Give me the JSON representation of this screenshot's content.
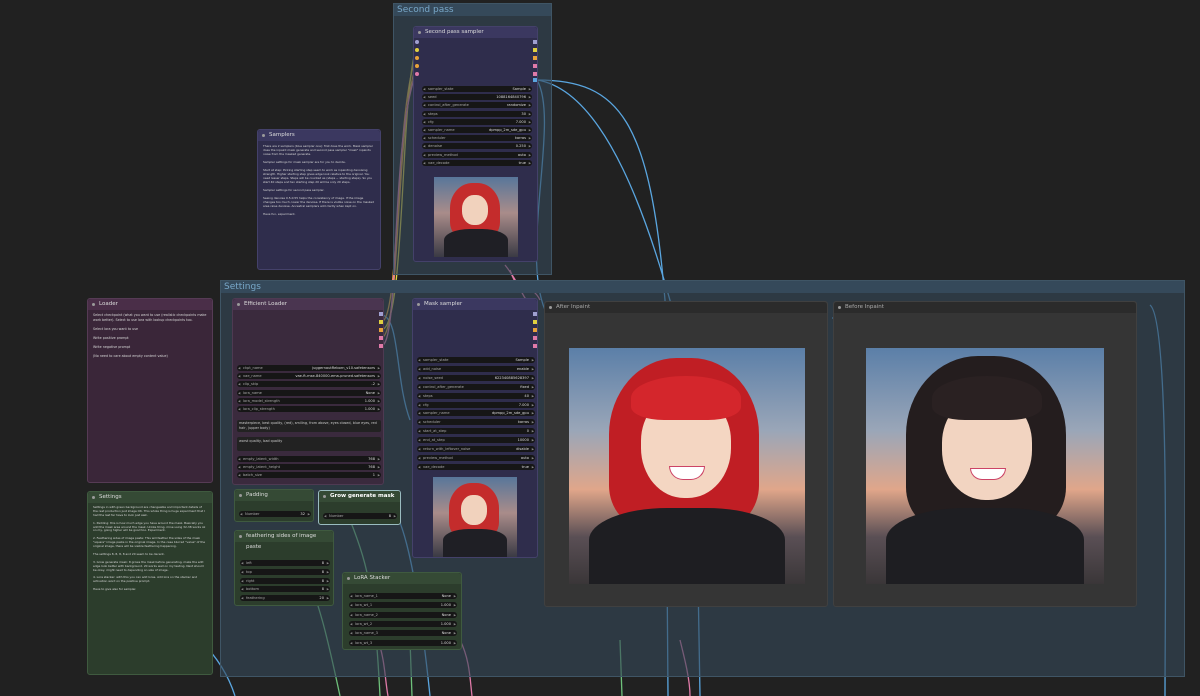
{
  "groups": {
    "second_pass": "Second pass",
    "settings": "Settings"
  },
  "nodes": {
    "loader": {
      "title": "Loader",
      "text": "Select checkpoint (what you want to use (realistic checkpoints make work better). Select to use lora with lookup checkpoints too.\n\nSelect lora you want to use\n\nWrite positive prompt\n\nWrite negative prompt\n\n(No need to care about empty content value)"
    },
    "samplers_note": {
      "title": "Samplers",
      "text": "There are 2 samplers (blue sampler one): first does the work. Mask sampler does the inpaint mask generate and second pass sampler \"mask\" inpaints noise from the masked generate.\n\nSampler settings for mask sampler are for you to decide.\n\nStart at step: Picking starting step seem to work as inpainting denoising strength. Higher starting step gives edge look relative to the original. You need lesser steps. Steps will be counted as (steps − starting steps). So you start 40 steps and ten starting step 20 will be only 20 steps.\n\nSampler settings for second pass sampler.\n\nSeeing denoise 0.5-0.55 helps the consistency of image. If the image changes too much, lower the denoise. If there is visible noise on the masked area raise denoise. Ancestral samplers add clarity when kept on.\n\nHave fun, experiment."
    },
    "settings_note": {
      "title": "Settings",
      "text": "Settings in with green background are changeable and important details of the rest production just image OK. This whole thing is huge experiment that I had the last far have to look just awk.\n\n1. Padding: this is how much edge you have around the mask. Basically you add the mask area around the mask. Unlike tiling, mine using 32-38 works ok on my, going higher will be good too. Experiment.\n\n2. Feathering sides of image paste: This will feather the sides of the mask \"square\" image paste in the original image. In the case blurred \"value\" of the original image, there will be visible feathering happening.\n\nThe settings 8, 8, 8, 8 and 20 seem to be decent.\n\n3. Grow generate mask: It grows the mask before generating, make the edit edge look better with background. 20 works well on my testing. Next should be okay, might need to depending on size of image.\n\n4. Lora stacker: with this you can add loras. Add lora on the stacker and activation word on the positive prompt.\n\nHave to give also for sampler."
    },
    "second_pass_sampler": {
      "title": "Second pass sampler",
      "widgets": [
        {
          "label": "sampler_state",
          "value": "Sample"
        },
        {
          "label": "seed",
          "value": "1088164840796"
        },
        {
          "label": "control_after_generate",
          "value": "randomize"
        },
        {
          "label": "steps",
          "value": "30"
        },
        {
          "label": "cfg",
          "value": "7.000"
        },
        {
          "label": "sampler_name",
          "value": "dpmpp_2m_sde_gpu"
        },
        {
          "label": "scheduler",
          "value": "karras"
        },
        {
          "label": "denoise",
          "value": "0.250"
        },
        {
          "label": "preview_method",
          "value": "auto"
        },
        {
          "label": "vae_decode",
          "value": "true"
        }
      ]
    },
    "efficient_loader": {
      "title": "Efficient Loader",
      "widgets": [
        {
          "label": "ckpt_name",
          "value": "juggernautReborn_v10.safetensors"
        },
        {
          "label": "vae_name",
          "value": "vae-ft-mse-840000-ema-pruned.safetensors"
        },
        {
          "label": "clip_skip",
          "value": "-2"
        },
        {
          "label": "lora_name",
          "value": "None"
        },
        {
          "label": "lora_model_strength",
          "value": "1.000"
        },
        {
          "label": "lora_clip_strength",
          "value": "1.000"
        }
      ],
      "positive": "masterpiece, best quality, (red), smiling, from above, eyes closed, blue eyes, red hair, (upper body)",
      "negative": "worst quality, bad quality",
      "widgets2": [
        {
          "label": "empty_latent_width",
          "value": "768"
        },
        {
          "label": "empty_latent_height",
          "value": "768"
        },
        {
          "label": "batch_size",
          "value": "1"
        }
      ]
    },
    "mask_sampler": {
      "title": "Mask sampler",
      "widgets": [
        {
          "label": "sampler_state",
          "value": "Sample"
        },
        {
          "label": "add_noise",
          "value": "enable"
        },
        {
          "label": "noise_seed",
          "value": "622340885628397"
        },
        {
          "label": "control_after_generate",
          "value": "fixed"
        },
        {
          "label": "steps",
          "value": "40"
        },
        {
          "label": "cfg",
          "value": "7.000"
        },
        {
          "label": "sampler_name",
          "value": "dpmpp_2m_sde_gpu"
        },
        {
          "label": "scheduler",
          "value": "karras"
        },
        {
          "label": "start_at_step",
          "value": "0"
        },
        {
          "label": "end_at_step",
          "value": "10000"
        },
        {
          "label": "return_with_leftover_noise",
          "value": "disable"
        },
        {
          "label": "preview_method",
          "value": "auto"
        },
        {
          "label": "vae_decode",
          "value": "true"
        }
      ]
    },
    "padding": {
      "title": "Padding",
      "widget": {
        "label": "Number",
        "value": "32"
      }
    },
    "grow_mask": {
      "title": "Grow generate mask",
      "widget": {
        "label": "Number",
        "value": "8"
      }
    },
    "feathering": {
      "title": "feathering sides of image paste",
      "widgets": [
        {
          "label": "left",
          "value": "8"
        },
        {
          "label": "top",
          "value": "8"
        },
        {
          "label": "right",
          "value": "8"
        },
        {
          "label": "bottom",
          "value": "8"
        },
        {
          "label": "feathering",
          "value": "20"
        }
      ]
    },
    "lora_stacker": {
      "title": "LoRA Stacker",
      "widgets": [
        {
          "label": "lora_name_1",
          "value": "None"
        },
        {
          "label": "lora_wt_1",
          "value": "1.000"
        },
        {
          "label": "lora_name_2",
          "value": "None"
        },
        {
          "label": "lora_wt_2",
          "value": "1.000"
        },
        {
          "label": "lora_name_3",
          "value": "None"
        },
        {
          "label": "lora_wt_3",
          "value": "1.000"
        }
      ]
    },
    "after_inpaint": {
      "title": "After Inpaint"
    },
    "before_inpaint": {
      "title": "Before Inpaint"
    }
  },
  "colors": {
    "canvas": "#212121",
    "link_blue": "#5aa6e0",
    "link_orange": "#e8a23a",
    "link_pink": "#e07aa8",
    "link_green": "#6ec07a",
    "link_yellow": "#e0d040"
  }
}
